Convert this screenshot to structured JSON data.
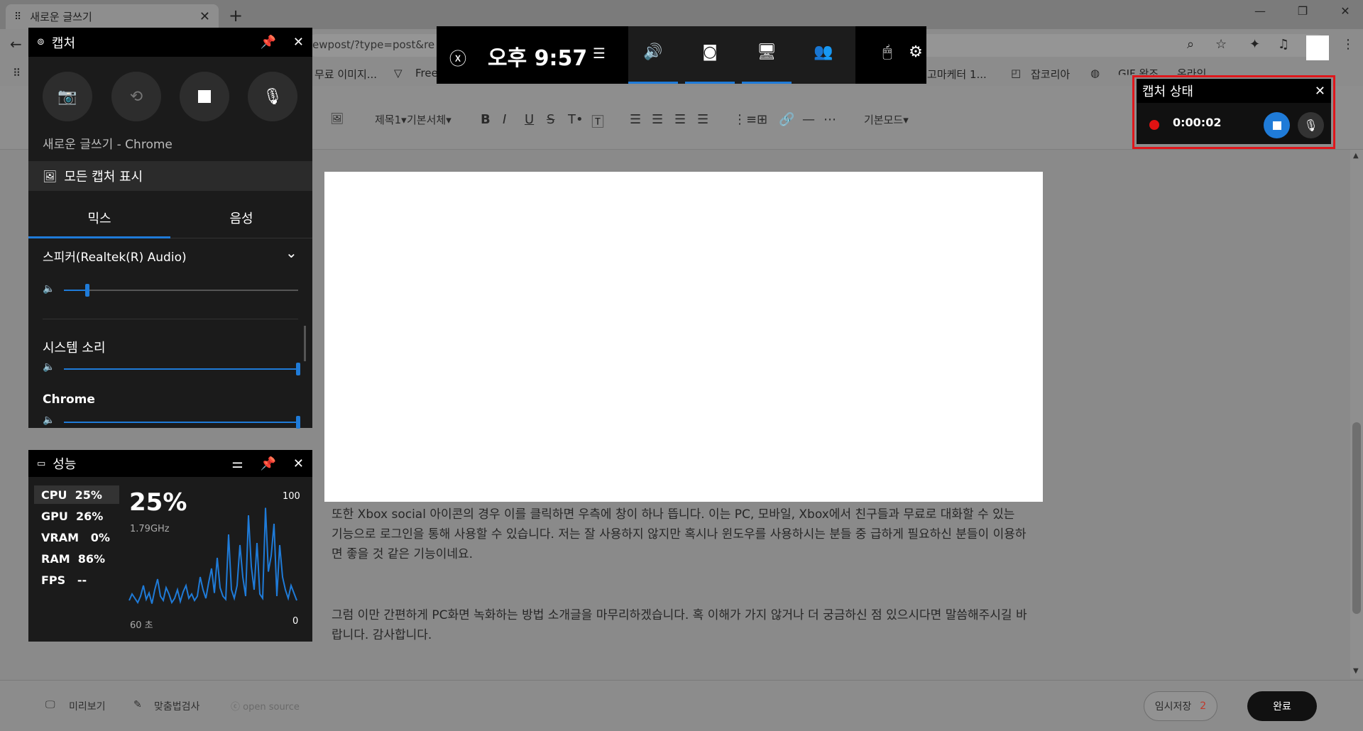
{
  "browser": {
    "tab_title": "새로운 글쓰기",
    "tab_close": "✕",
    "new_tab": "+",
    "url": "ewpost/?type=post&re",
    "bookmarks": [
      "무료 이미지...",
      "Free",
      "고마케터 1...",
      "잡코리아",
      "GIF 왕조",
      "온라인"
    ]
  },
  "editor": {
    "toolbar": {
      "image": "🖼",
      "heading": "제목1",
      "font": "기본서체",
      "mode": "기본모드"
    },
    "paragraph1": "또한 Xbox social 아이콘의 경우 이를 클릭하면 우측에 창이 하나 뜹니다. 이는 PC, 모바일, Xbox에서 친구들과 무료로 대화할 수 있는 기능으로 로그인을 통해 사용할 수 있습니다. 저는 잘 사용하지 않지만 혹시나 윈도우를 사용하시는 분들 중 급하게 필요하신 분들이 이용하면 좋을 것 같은 기능이네요.",
    "paragraph2": "그럼 이만 간편하게 PC화면 녹화하는 방법 소개글을 마무리하겠습니다. 혹 이해가 가지 않거나 더 궁금하신 점 있으시다면 말씀해주시길 바랍니다. 감사합니다.",
    "bottom": {
      "preview": "미리보기",
      "spellcheck": "맞춤법검사",
      "open_source": "open source",
      "temp_save": "임시저장",
      "temp_save_count": "2",
      "done": "완료"
    }
  },
  "xbox_bar": {
    "time": "오후 9:57"
  },
  "capture": {
    "title": "캡처",
    "source": "새로운 글쓰기 - Chrome",
    "show_all": "모든 캡처 표시",
    "tabs": [
      "믹스",
      "음성"
    ],
    "device": "스피커(Realtek(R) Audio)",
    "speaker_level": 0.1,
    "system_sound_label": "시스템 소리",
    "system_level": 1.0,
    "chrome_label": "Chrome",
    "chrome_level": 1.0
  },
  "performance": {
    "title": "성능",
    "stats": [
      {
        "name": "CPU",
        "value": "25%"
      },
      {
        "name": "GPU",
        "value": "26%"
      },
      {
        "name": "VRAM",
        "value": "0%"
      },
      {
        "name": "RAM",
        "value": "86%"
      },
      {
        "name": "FPS",
        "value": "--"
      }
    ],
    "big_value": "25%",
    "freq": "1.79GHz",
    "y_max": "100",
    "y_min": "0",
    "x_label": "60 초",
    "cpu_history": [
      8,
      14,
      10,
      6,
      12,
      22,
      9,
      15,
      5,
      18,
      28,
      12,
      8,
      20,
      14,
      6,
      10,
      18,
      7,
      16,
      22,
      10,
      14,
      8,
      12,
      30,
      18,
      10,
      25,
      38,
      15,
      48,
      20,
      12,
      9,
      70,
      18,
      10,
      22,
      60,
      30,
      12,
      88,
      40,
      18,
      62,
      14,
      10,
      95,
      35,
      50,
      80,
      12,
      60,
      30,
      18,
      10,
      22,
      15,
      8
    ]
  },
  "status": {
    "title": "캡처 상태",
    "timer": "0:00:02"
  }
}
